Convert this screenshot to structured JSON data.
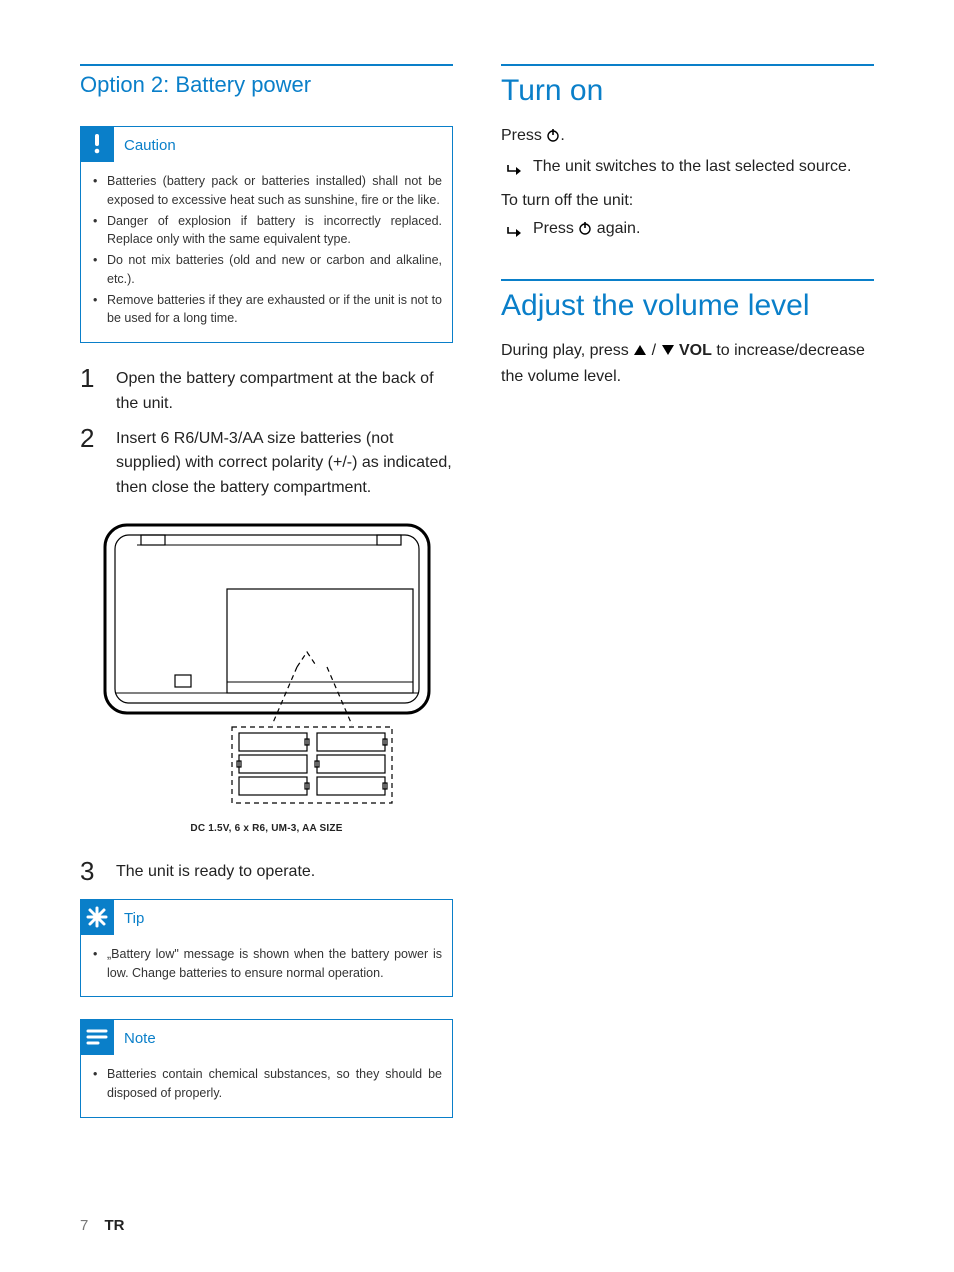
{
  "left": {
    "subheading": "Option 2: Battery power",
    "caution": {
      "title": "Caution",
      "items": [
        "Batteries (battery pack or batteries installed) shall not be exposed to excessive heat such as sunshine, fire or the like.",
        "Danger of explosion if battery is incorrectly replaced. Replace only with the same equivalent type.",
        "Do not mix batteries (old and new or carbon and alkaline, etc.).",
        "Remove batteries if they are exhausted or if the unit is not to be used for a long time."
      ]
    },
    "steps": [
      {
        "n": "1",
        "t": "Open the battery compartment at the back of the unit."
      },
      {
        "n": "2",
        "t": "Insert 6 R6/UM-3/AA size batteries (not supplied) with correct polarity (+/-) as indicated, then close the battery compartment."
      },
      {
        "n": "3",
        "t": "The unit is ready to operate."
      }
    ],
    "diagram_caption": "DC 1.5V, 6 x R6, UM-3, AA SIZE",
    "tip": {
      "title": "Tip",
      "items": [
        "„Battery low\" message is shown when the battery power is low. Change batteries to ensure normal operation."
      ]
    },
    "note": {
      "title": "Note",
      "items": [
        "Batteries contain chemical substances, so they should be disposed of properly."
      ]
    }
  },
  "right": {
    "turn_on": {
      "heading": "Turn on",
      "press_pre": "Press ",
      "press_post": ".",
      "result": "The unit switches to the last selected source.",
      "off_intro": "To turn off the unit:",
      "off_action_pre": "Press ",
      "off_action_post": " again."
    },
    "volume": {
      "heading": "Adjust the volume level",
      "line_pre": "During play, press ",
      "vol_label": "VOL",
      "line_post": " to increase/decrease the volume level."
    }
  },
  "footer": {
    "page": "7",
    "lang": "TR"
  }
}
